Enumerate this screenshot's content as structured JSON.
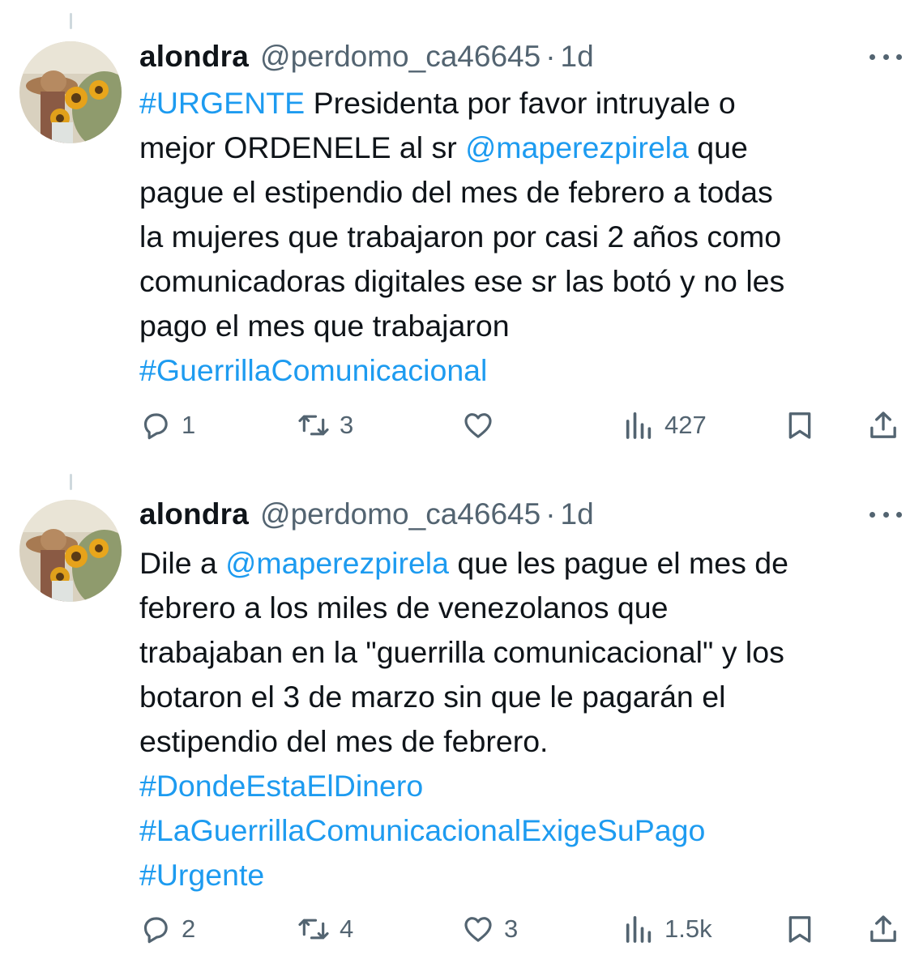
{
  "tweets": [
    {
      "author_name": "alondra",
      "handle": "@perdomo_ca46645",
      "separator": "·",
      "time": "1d",
      "lines": [
        [
          {
            "t": "#URGENTE",
            "link": true
          },
          {
            "t": " Presidenta por favor intruyale o",
            "link": false
          }
        ],
        [
          {
            "t": "mejor ORDENELE al sr ",
            "link": false
          },
          {
            "t": "@maperezpirela",
            "link": true
          },
          {
            "t": " que",
            "link": false
          }
        ],
        [
          {
            "t": "pague el estipendio del mes de febrero a todas",
            "link": false
          }
        ],
        [
          {
            "t": "la mujeres que trabajaron por casi 2 años como",
            "link": false
          }
        ],
        [
          {
            "t": "comunicadoras digitales ese sr las botó y no les",
            "link": false
          }
        ],
        [
          {
            "t": "pago el mes que trabajaron",
            "link": false
          }
        ],
        [
          {
            "t": "#GuerrillaComunicacional",
            "link": true
          }
        ]
      ],
      "actions": {
        "reply_count": "1",
        "retweet_count": "3",
        "like_count": "",
        "views_count": "427"
      }
    },
    {
      "author_name": "alondra",
      "handle": "@perdomo_ca46645",
      "separator": "·",
      "time": "1d",
      "lines": [
        [
          {
            "t": "Dile a ",
            "link": false
          },
          {
            "t": "@maperezpirela",
            "link": true
          },
          {
            "t": " que les pague el mes de",
            "link": false
          }
        ],
        [
          {
            "t": "febrero a los miles de venezolanos que",
            "link": false
          }
        ],
        [
          {
            "t": "trabajaban en la \"guerrilla comunicacional\" y los",
            "link": false
          }
        ],
        [
          {
            "t": "botaron el 3 de marzo sin que le pagarán el",
            "link": false
          }
        ],
        [
          {
            "t": "estipendio del mes de febrero.",
            "link": false
          }
        ],
        [
          {
            "t": "#DondeEstaElDinero",
            "link": true
          }
        ],
        [
          {
            "t": "#LaGuerrillaComunicacionalExigeSuPago",
            "link": true
          }
        ],
        [
          {
            "t": "#Urgente",
            "link": true
          }
        ]
      ],
      "actions": {
        "reply_count": "2",
        "retweet_count": "4",
        "like_count": "3",
        "views_count": "1.5k"
      }
    }
  ],
  "colors": {
    "text": "#0f1419",
    "secondary": "#536471",
    "link": "#1d9bf0",
    "thread_line": "#cfd9de"
  },
  "icons": [
    "reply-icon",
    "retweet-icon",
    "like-icon",
    "views-icon",
    "bookmark-icon",
    "share-icon",
    "more-options-icon"
  ]
}
